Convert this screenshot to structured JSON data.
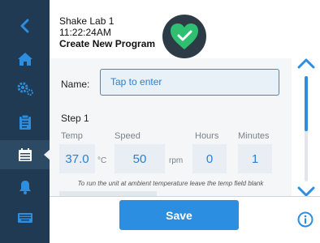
{
  "header": {
    "device_name": "Shake Lab 1",
    "time": "11:22:24AM",
    "page_title": "Create New Program"
  },
  "form": {
    "name_label": "Name:",
    "name_placeholder": "Tap to enter",
    "step_label": "Step 1",
    "fields": {
      "temp": {
        "label": "Temp",
        "value": "37.0",
        "unit": "°C"
      },
      "speed": {
        "label": "Speed",
        "value": "50",
        "unit": "rpm"
      },
      "hours": {
        "label": "Hours",
        "value": "0"
      },
      "minutes": {
        "label": "Minutes",
        "value": "1"
      }
    },
    "hint": "To run the unit at ambient temperature leave the temp field blank"
  },
  "actions": {
    "save_label": "Save"
  },
  "sidebar": {
    "items": [
      {
        "icon": "back-chevron-icon"
      },
      {
        "icon": "home-icon"
      },
      {
        "icon": "settings-gears-icon"
      },
      {
        "icon": "clipboard-icon"
      },
      {
        "icon": "programs-icon",
        "active": true
      },
      {
        "icon": "bell-icon"
      },
      {
        "icon": "keyboard-icon"
      }
    ]
  },
  "colors": {
    "sidebar": "#1f3a52",
    "accent": "#2b8ee0",
    "status_ok": "#2fbf71",
    "badge_bg": "#2d3b47"
  },
  "scroll": {
    "position": 0.0,
    "visible_fraction": 0.52
  }
}
